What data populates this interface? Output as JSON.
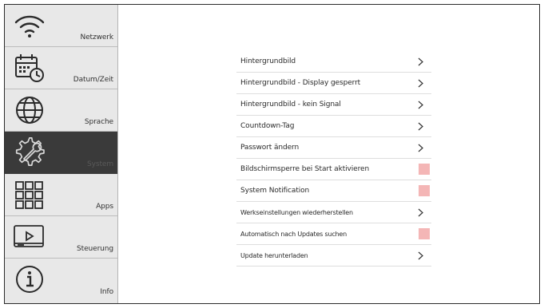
{
  "sidebar": {
    "items": [
      {
        "label": "Netzwerk",
        "icon": "wifi-icon"
      },
      {
        "label": "Datum/Zeit",
        "icon": "calendar-clock-icon"
      },
      {
        "label": "Sprache",
        "icon": "globe-icon"
      },
      {
        "label": "System",
        "icon": "wrench-gear-icon",
        "active": true
      },
      {
        "label": "Apps",
        "icon": "apps-grid-icon"
      },
      {
        "label": "Steuerung",
        "icon": "remote-control-icon"
      },
      {
        "label": "Info",
        "icon": "info-icon"
      }
    ]
  },
  "settings": {
    "rows": [
      {
        "label": "Hintergrundbild",
        "control": "chevron"
      },
      {
        "label": "Hintergrundbild - Display gesperrt",
        "control": "chevron"
      },
      {
        "label": "Hintergrundbild - kein Signal",
        "control": "chevron"
      },
      {
        "label": "Countdown-Tag",
        "control": "chevron"
      },
      {
        "label": "Passwort ändern",
        "control": "chevron"
      },
      {
        "label": "Bildschirmsperre bei Start aktivieren",
        "control": "toggle"
      },
      {
        "label": "System Notification",
        "control": "toggle"
      },
      {
        "label": "Werkseinstellungen wiederherstellen",
        "control": "chevron"
      },
      {
        "label": "Automatisch nach Updates suchen",
        "control": "toggle"
      },
      {
        "label": "Update herunterladen",
        "control": "chevron"
      }
    ]
  },
  "colors": {
    "sidebar_bg": "#e8e8e8",
    "active_bg": "#3a3a3a",
    "toggle_off": "#f4b6b6",
    "divider": "#dedede"
  }
}
